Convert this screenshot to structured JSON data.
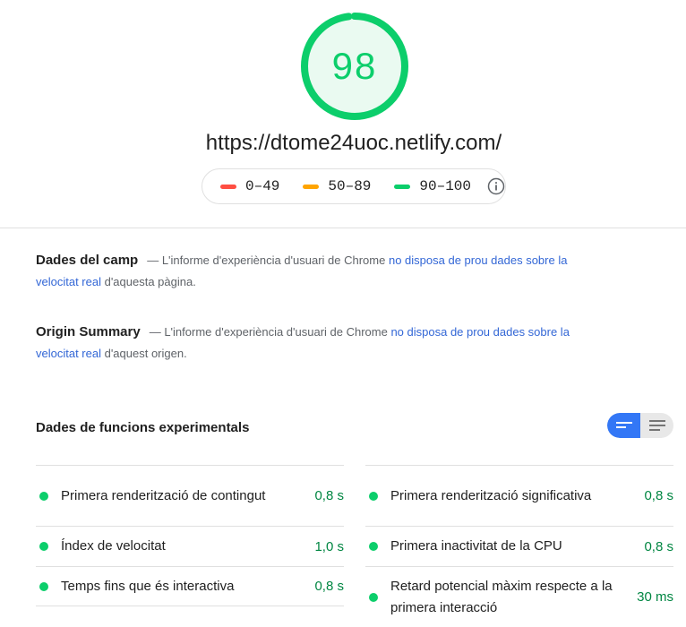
{
  "score": {
    "value": "98",
    "fraction": 0.98,
    "color": "#0cce6b"
  },
  "url": "https://dtome24uoc.netlify.com/",
  "legend": {
    "items": [
      {
        "range": "0–49",
        "color": "#ff4e42"
      },
      {
        "range": "50–89",
        "color": "#ffa400"
      },
      {
        "range": "90–100",
        "color": "#0cce6b"
      }
    ],
    "info_icon": "info-icon"
  },
  "field_data": {
    "heading": "Dades del camp",
    "text_before": "— L'informe d'experiència d'usuari de Chrome ",
    "link": "no disposa de prou dades sobre la velocitat real",
    "text_after": " d'aquesta pàgina."
  },
  "origin_summary": {
    "heading": "Origin Summary",
    "text_before": "— L'informe d'experiència d'usuari de Chrome ",
    "link": "no disposa de prou dades sobre la velocitat real",
    "text_after": " d'aquest origen."
  },
  "lab": {
    "heading": "Dades de funcions experimentals",
    "toggle": {
      "active": "compact-view-icon",
      "inactive": "expanded-view-icon"
    },
    "left_metrics": [
      {
        "label": "Primera renderització de contingut",
        "value": "0,8 s"
      },
      {
        "label": "Índex de velocitat",
        "value": "1,0 s"
      },
      {
        "label": "Temps fins que és interactiva",
        "value": "0,8 s"
      }
    ],
    "right_metrics": [
      {
        "label": "Primera renderització significativa",
        "value": "0,8 s"
      },
      {
        "label": "Primera inactivitat de la CPU",
        "value": "0,8 s"
      },
      {
        "label": "Retard potencial màxim respecte a la primera interacció",
        "value": "30 ms"
      }
    ]
  }
}
